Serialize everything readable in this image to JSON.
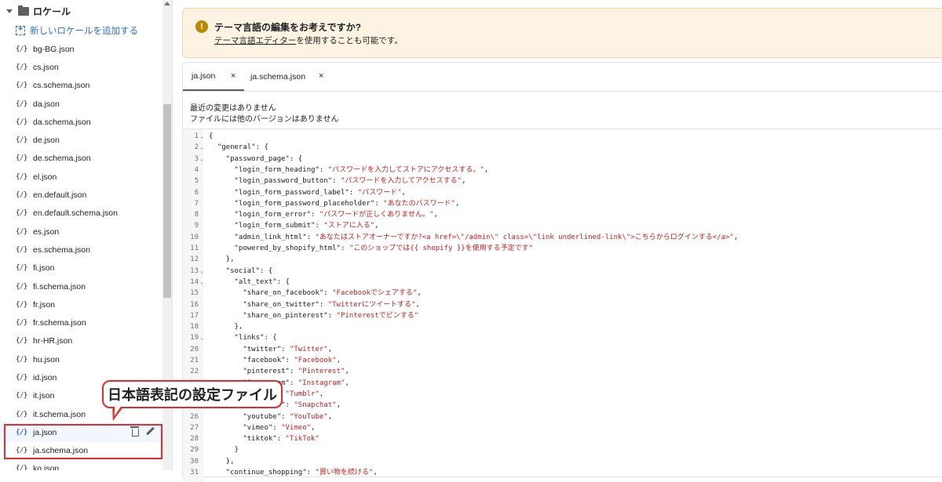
{
  "sidebar": {
    "folder_label": "ロケール",
    "add_label": "新しいロケールを追加する",
    "json_icon": "{/}",
    "files": [
      "bg-BG.json",
      "cs.json",
      "cs.schema.json",
      "da.json",
      "da.schema.json",
      "de.json",
      "de.schema.json",
      "el.json",
      "en.default.json",
      "en.default.schema.json",
      "es.json",
      "es.schema.json",
      "fi.json",
      "fi.schema.json",
      "fr.json",
      "fr.schema.json",
      "hr-HR.json",
      "hu.json",
      "id.json",
      "it.json",
      "it.schema.json",
      "ja.json",
      "ja.schema.json",
      "ko.json"
    ],
    "active_file": "ja.json"
  },
  "callout": {
    "text": "日本語表記の設定ファイル"
  },
  "banner": {
    "icon": "!",
    "title": "テーマ言語の編集をお考えですか?",
    "link": "テーマ言語エディター",
    "body_rest": "を使用することも可能です。"
  },
  "tabs": [
    {
      "label": "ja.json",
      "close": "×"
    },
    {
      "label": "ja.schema.json",
      "close": "×"
    }
  ],
  "status": {
    "line1": "最近の変更はありません",
    "line2": "ファイルには他のバージョンはありません"
  },
  "code_lines": [
    {
      "n": "1",
      "fold": true,
      "t": "{"
    },
    {
      "n": "2",
      "fold": true,
      "t": "  \"general\": {"
    },
    {
      "n": "3",
      "fold": true,
      "t": "    \"password_page\": {"
    },
    {
      "n": "4",
      "k": "      \"login_form_heading\": ",
      "v": "\"パスワードを入力してストアにアクセスする。\"",
      "e": ","
    },
    {
      "n": "5",
      "k": "      \"login_password_button\": ",
      "v": "\"パスワードを入力してアクセスする\"",
      "e": ","
    },
    {
      "n": "6",
      "k": "      \"login_form_password_label\": ",
      "v": "\"パスワード\"",
      "e": ","
    },
    {
      "n": "7",
      "k": "      \"login_form_password_placeholder\": ",
      "v": "\"あなたのパスワード\"",
      "e": ","
    },
    {
      "n": "8",
      "k": "      \"login_form_error\": ",
      "v": "\"パスワードが正しくありません。\"",
      "e": ","
    },
    {
      "n": "9",
      "k": "      \"login_form_submit\": ",
      "v": "\"ストアに入る\"",
      "e": ","
    },
    {
      "n": "10",
      "k": "      \"admin_link_html\": ",
      "v": "\"あなたはストアオーナーですか?<a href=\\\"/admin\\\" class=\\\"link underlined-link\\\">こちらからログインする</a>\"",
      "e": ","
    },
    {
      "n": "11",
      "k": "      \"powered_by_shopify_html\": ",
      "v": "\"このショップでは{{ shopify }}を使用する予定です\"",
      "e": ""
    },
    {
      "n": "12",
      "t": "    },"
    },
    {
      "n": "13",
      "fold": true,
      "t": "    \"social\": {"
    },
    {
      "n": "14",
      "fold": true,
      "t": "      \"alt_text\": {"
    },
    {
      "n": "15",
      "k": "        \"share_on_facebook\": ",
      "v": "\"Facebookでシェアする\"",
      "e": ","
    },
    {
      "n": "16",
      "k": "        \"share_on_twitter\": ",
      "v": "\"Twitterにツイートする\"",
      "e": ","
    },
    {
      "n": "17",
      "k": "        \"share_on_pinterest\": ",
      "v": "\"Pinterestでピンする\"",
      "e": ""
    },
    {
      "n": "18",
      "t": "      },"
    },
    {
      "n": "19",
      "fold": true,
      "t": "      \"links\": {"
    },
    {
      "n": "20",
      "k": "        \"twitter\": ",
      "v": "\"Twitter\"",
      "e": ","
    },
    {
      "n": "21",
      "k": "        \"facebook\": ",
      "v": "\"Facebook\"",
      "e": ","
    },
    {
      "n": "22",
      "k": "        \"pinterest\": ",
      "v": "\"Pinterest\"",
      "e": ","
    },
    {
      "n": "23",
      "k": "        \"instagram\": ",
      "v": "\"Instagram\"",
      "e": ","
    },
    {
      "n": "24",
      "k": "        \"tumblr\": ",
      "v": "\"Tumblr\"",
      "e": ","
    },
    {
      "n": "25",
      "k": "        \"snapchat\": ",
      "v": "\"Snapchat\"",
      "e": ","
    },
    {
      "n": "26",
      "k": "        \"youtube\": ",
      "v": "\"YouTube\"",
      "e": ","
    },
    {
      "n": "27",
      "k": "        \"vimeo\": ",
      "v": "\"Vimeo\"",
      "e": ","
    },
    {
      "n": "28",
      "k": "        \"tiktok\": ",
      "v": "\"TikTok\"",
      "e": ""
    },
    {
      "n": "29",
      "t": "      }"
    },
    {
      "n": "30",
      "t": "    },"
    },
    {
      "n": "31",
      "k": "    \"continue_shopping\": ",
      "v": "\"買い物を続ける\"",
      "e": ","
    }
  ]
}
